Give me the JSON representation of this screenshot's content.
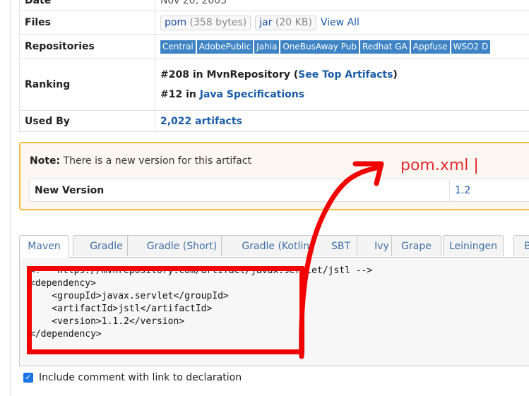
{
  "info": {
    "date_label": "Date",
    "date_value": "Nov 20, 2005",
    "files_label": "Files",
    "files": [
      {
        "name": "pom",
        "size": "(358 bytes)"
      },
      {
        "name": "jar",
        "size": "(20 KB)"
      }
    ],
    "view_all": "View All",
    "repositories_label": "Repositories",
    "repositories": [
      "Central",
      "AdobePublic",
      "Jahia",
      "OneBusAway Pub",
      "Redhat GA",
      "Appfuse",
      "WSO2 D"
    ],
    "ranking_label": "Ranking",
    "rank1_prefix": "#208 in MvnRepository (",
    "rank1_link": "See Top Artifacts",
    "rank1_suffix": ")",
    "rank2_prefix": "#12 in ",
    "rank2_link": "Java Specifications",
    "used_by_label": "Used By",
    "used_by_value": "2,022 artifacts"
  },
  "note": {
    "bold": "Note:",
    "text": " There is a new version for this artifact",
    "new_version_label": "New Version",
    "new_version_value": "1.2"
  },
  "handwriting": "pom.xml |",
  "tabs": [
    "Maven",
    "Gradle",
    "Gradle (Short)",
    "Gradle (Kotlin)",
    "SBT",
    "Ivy",
    "Grape",
    "Leiningen",
    "B"
  ],
  "active_tab": "Maven",
  "code": "<!-- https://mvnrepository.com/artifact/javax.servlet/jstl -->\n<dependency>\n    <groupId>javax.servlet</groupId>\n    <artifactId>jstl</artifactId>\n    <version>1.1.2</version>\n</dependency>",
  "include_comment_label": "Include comment with link to declaration",
  "colors": {
    "accent_blue": "#1a5ca8",
    "repo_tag_bg": "#3e84c4",
    "note_border": "#f2c141",
    "annotation_red": "#f00200"
  }
}
